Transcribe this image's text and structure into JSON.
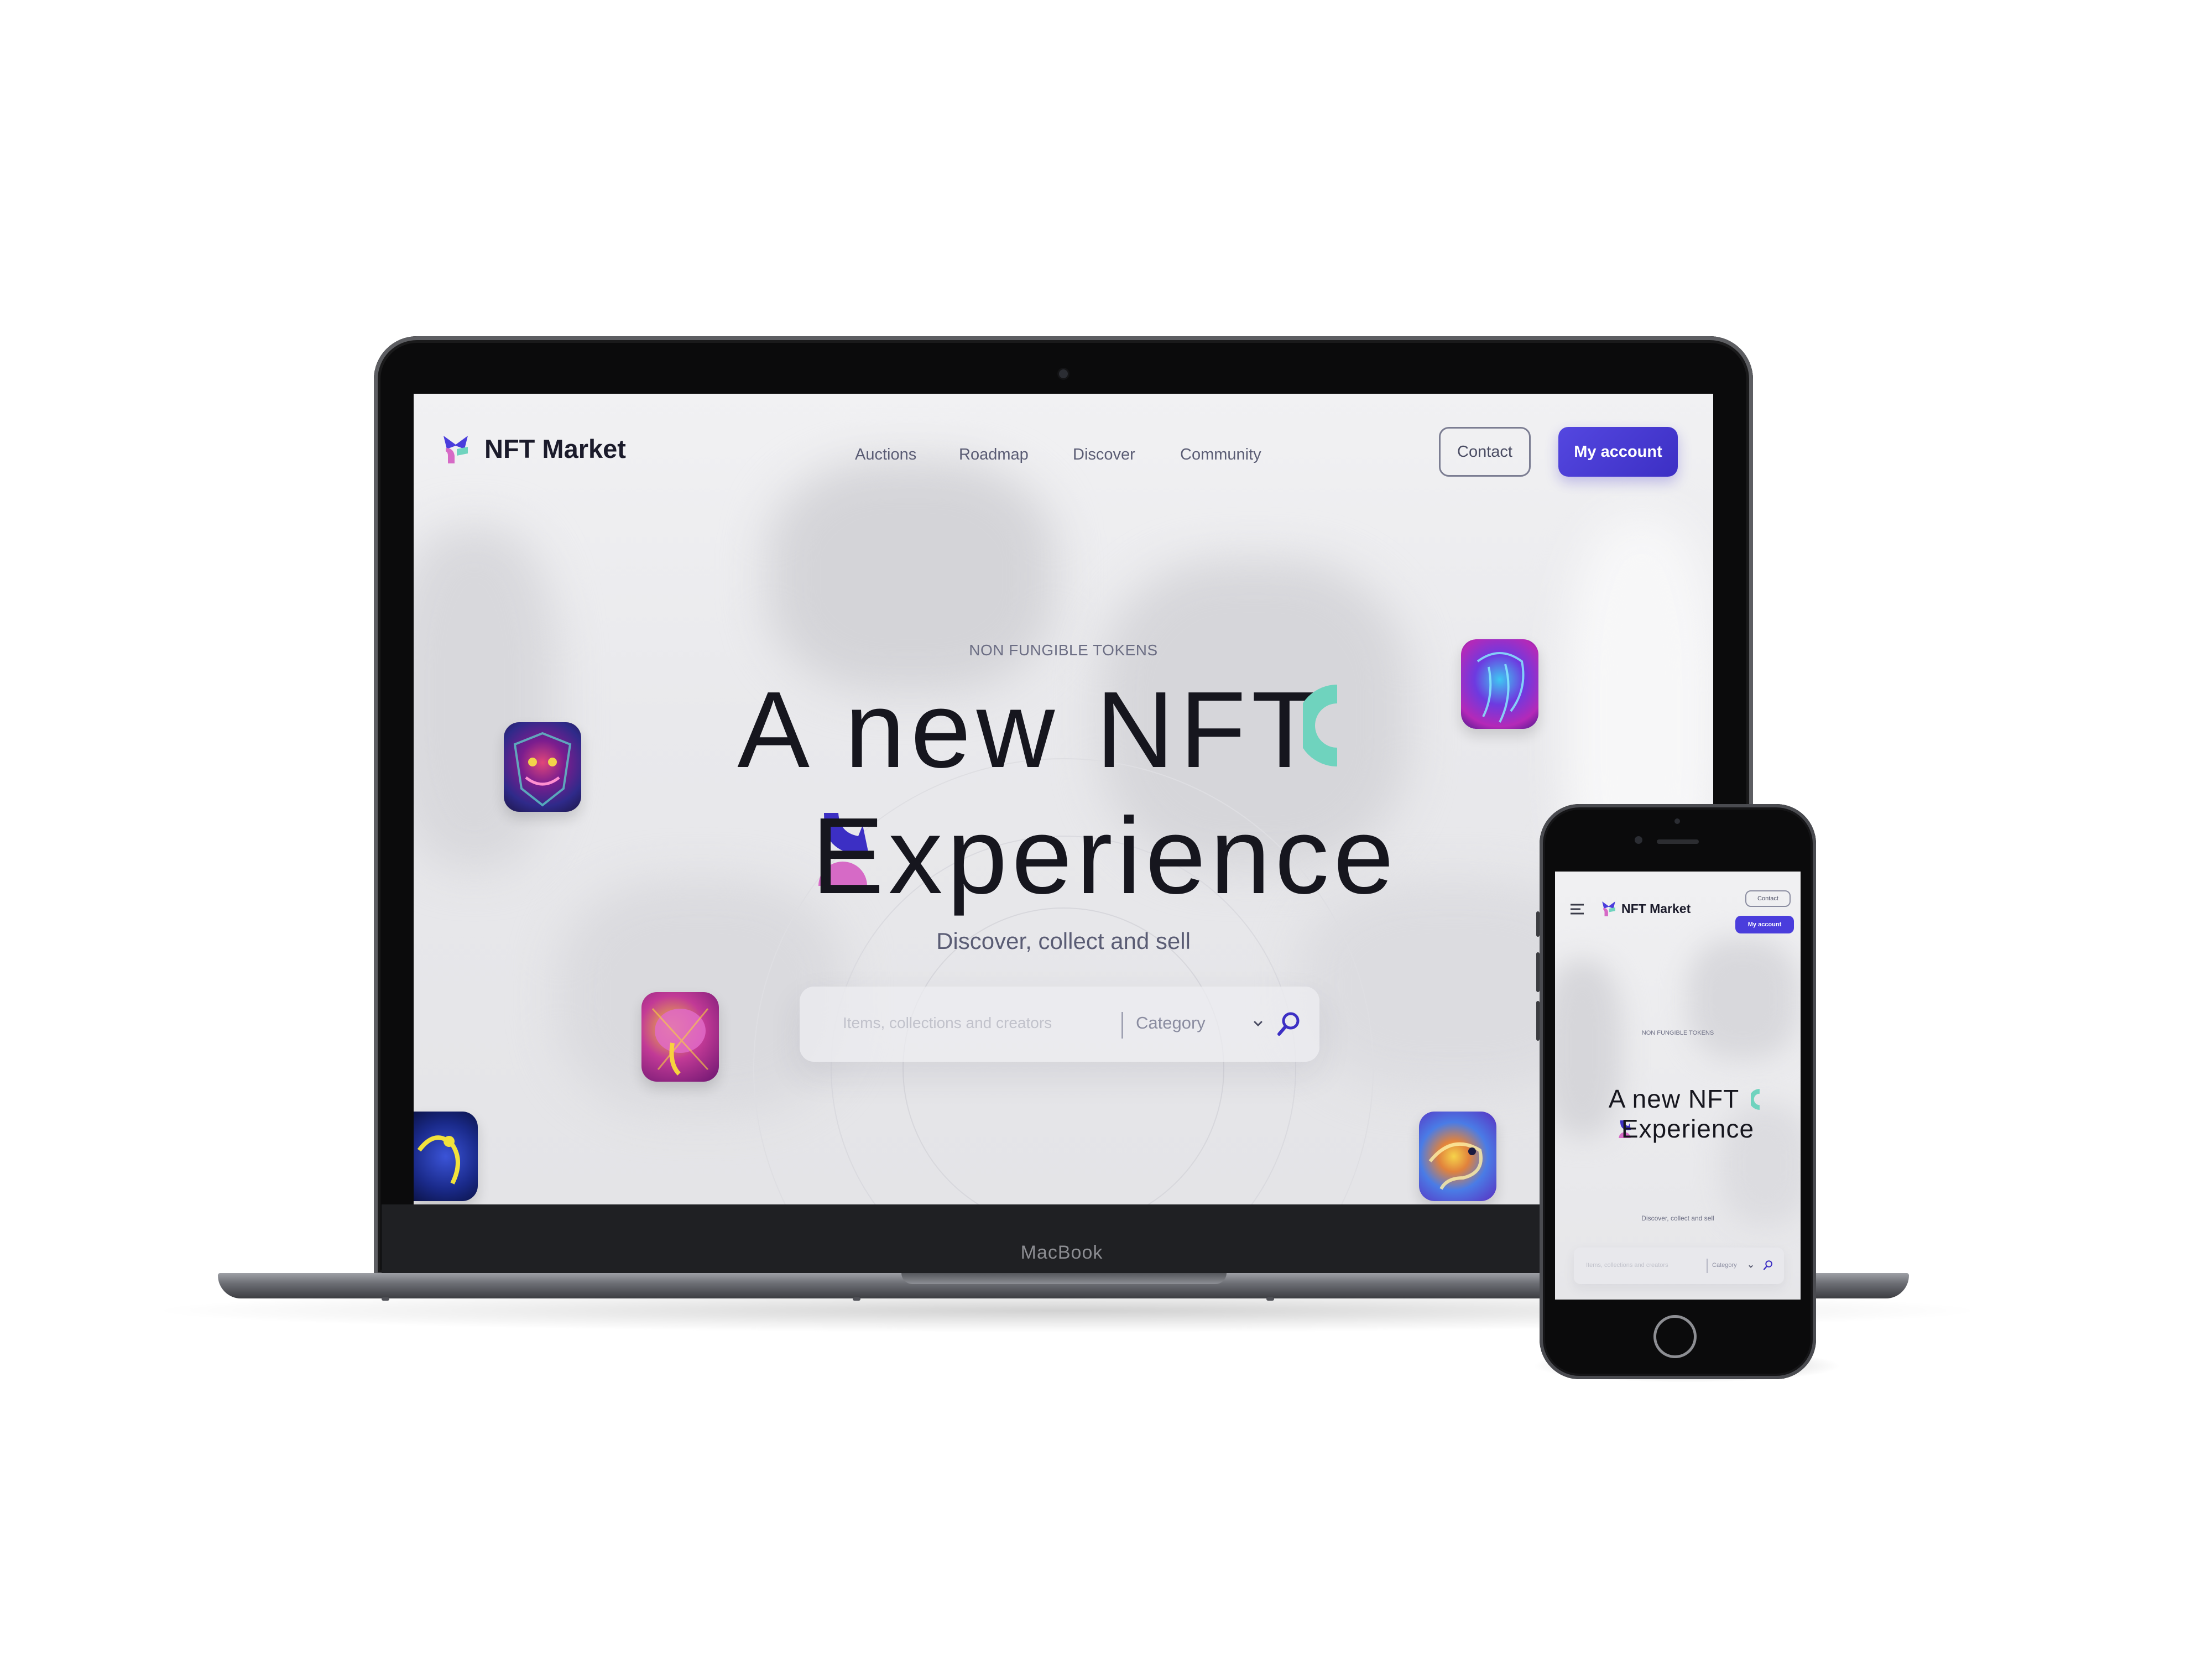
{
  "brand_colors": {
    "accent": "#4a3ddc",
    "logo_blue": "#3c2fc4",
    "logo_pink": "#d66ac6",
    "logo_teal": "#6fd3be",
    "text_dark": "#16161e"
  },
  "desktop": {
    "brand": "NFT Market",
    "nav": [
      {
        "label": "Auctions",
        "icon": null
      },
      {
        "label": "Roadmap",
        "icon": null
      },
      {
        "label": "Discover",
        "icon": null
      },
      {
        "label": "Community",
        "icon": null
      }
    ],
    "contact_label": "Contact",
    "account_label": "My account",
    "eyebrow": "NON FUNGIBLE TOKENS",
    "hero_line1": "A new NFT",
    "hero_line2": "Experience",
    "tagline": "Discover, collect and sell",
    "search": {
      "placeholder": "Items, collections and creators",
      "category_label": "Category",
      "search_icon": "search-icon",
      "chevron_icon": "chevron-down-icon"
    }
  },
  "device_label": "MacBook",
  "mobile": {
    "brand": "NFT Market",
    "menu_icon": "hamburger-icon",
    "contact_label": "Contact",
    "account_label": "My account",
    "eyebrow": "NON FUNGIBLE TOKENS",
    "hero_line1": "A new NFT",
    "hero_line2": "Experience",
    "tagline": "Discover, collect and sell",
    "search": {
      "placeholder": "Items, collections and creators",
      "category_label": "Category"
    }
  }
}
